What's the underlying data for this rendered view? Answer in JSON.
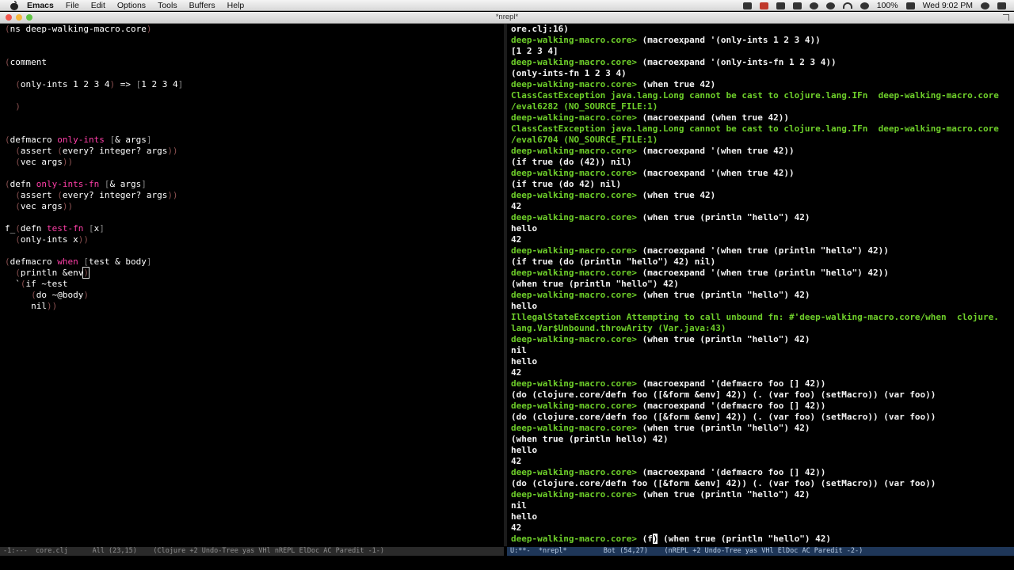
{
  "menubar": {
    "app": "Emacs",
    "items": [
      "File",
      "Edit",
      "Options",
      "Tools",
      "Buffers",
      "Help"
    ],
    "battery": "100%",
    "clock": "Wed 9:02 PM"
  },
  "window": {
    "title": "*nrepl*"
  },
  "editor": {
    "ns": "ns deep-walking-macro.core",
    "comment": "comment",
    "comment_body": "only-ints 1 2 3 4",
    "comment_arrow": " => ",
    "comment_result": "1 2 3 4",
    "defmacro1_kw": "defmacro",
    "defmacro1_name": "only-ints",
    "defmacro1_args": "& args",
    "assert1": "assert ",
    "every1": "every? integer? args",
    "vec1": "vec args",
    "defn1_kw": "defn",
    "defn1_name": "only-ints-fn",
    "defn1_args": "& args",
    "assert2": "assert ",
    "every2": "every? integer? args",
    "vec2": "vec args",
    "fringe_mark": "f_",
    "defn2_kw": "defn",
    "defn2_name": "test-fn",
    "defn2_args": "x",
    "only_ints_x": "only-ints x",
    "defmacro2_kw": "defmacro",
    "defmacro2_name": "when",
    "defmacro2_args": "test & body",
    "println_env": "println &env",
    "if_test": "if ~test",
    "do_body": "do ~@body",
    "nil": "nil"
  },
  "repl": {
    "lines": [
      {
        "t": "out",
        "s": "ore.clj:16)"
      },
      {
        "t": "prompt",
        "p": "deep-walking-macro.core> ",
        "s": "(macroexpand '(only-ints 1 2 3 4))"
      },
      {
        "t": "out",
        "s": "[1 2 3 4]"
      },
      {
        "t": "prompt",
        "p": "deep-walking-macro.core> ",
        "s": "(macroexpand '(only-ints-fn 1 2 3 4))"
      },
      {
        "t": "out",
        "s": "(only-ints-fn 1 2 3 4)"
      },
      {
        "t": "prompt",
        "p": "deep-walking-macro.core> ",
        "s": "(when true 42)"
      },
      {
        "t": "err",
        "s": "ClassCastException java.lang.Long cannot be cast to clojure.lang.IFn  deep-walking-macro.core"
      },
      {
        "t": "err",
        "s": "/eval6282 (NO_SOURCE_FILE:1)"
      },
      {
        "t": "prompt",
        "p": "deep-walking-macro.core> ",
        "s": "(macroexpand (when true 42))"
      },
      {
        "t": "err",
        "s": "ClassCastException java.lang.Long cannot be cast to clojure.lang.IFn  deep-walking-macro.core"
      },
      {
        "t": "err",
        "s": "/eval6704 (NO_SOURCE_FILE:1)"
      },
      {
        "t": "prompt",
        "p": "deep-walking-macro.core> ",
        "s": "(macroexpand '(when true 42))"
      },
      {
        "t": "out",
        "s": "(if true (do (42)) nil)"
      },
      {
        "t": "prompt",
        "p": "deep-walking-macro.core> ",
        "s": "(macroexpand '(when true 42))"
      },
      {
        "t": "out",
        "s": "(if true (do 42) nil)"
      },
      {
        "t": "prompt",
        "p": "deep-walking-macro.core> ",
        "s": "(when true 42)"
      },
      {
        "t": "out",
        "s": "42"
      },
      {
        "t": "prompt",
        "p": "deep-walking-macro.core> ",
        "s": "(when true (println \"hello\") 42)"
      },
      {
        "t": "out",
        "s": "hello"
      },
      {
        "t": "out",
        "s": "42"
      },
      {
        "t": "prompt",
        "p": "deep-walking-macro.core> ",
        "s": "(macroexpand '(when true (println \"hello\") 42))"
      },
      {
        "t": "out",
        "s": "(if true (do (println \"hello\") 42) nil)"
      },
      {
        "t": "prompt",
        "p": "deep-walking-macro.core> ",
        "s": "(macroexpand '(when true (println \"hello\") 42))"
      },
      {
        "t": "out",
        "s": "(when true (println \"hello\") 42)"
      },
      {
        "t": "prompt",
        "p": "deep-walking-macro.core> ",
        "s": "(when true (println \"hello\") 42)"
      },
      {
        "t": "out",
        "s": "hello"
      },
      {
        "t": "err",
        "s": "IllegalStateException Attempting to call unbound fn: #'deep-walking-macro.core/when  clojure."
      },
      {
        "t": "err",
        "s": "lang.Var$Unbound.throwArity (Var.java:43)"
      },
      {
        "t": "prompt",
        "p": "deep-walking-macro.core> ",
        "s": "(when true (println \"hello\") 42)"
      },
      {
        "t": "out",
        "s": "nil"
      },
      {
        "t": "out",
        "s": "hello"
      },
      {
        "t": "out",
        "s": "42"
      },
      {
        "t": "prompt",
        "p": "deep-walking-macro.core> ",
        "s": "(macroexpand '(defmacro foo [] 42))"
      },
      {
        "t": "out",
        "s": "(do (clojure.core/defn foo ([&form &env] 42)) (. (var foo) (setMacro)) (var foo))"
      },
      {
        "t": "prompt",
        "p": "deep-walking-macro.core> ",
        "s": "(macroexpand '(defmacro foo [] 42))"
      },
      {
        "t": "out",
        "s": "(do (clojure.core/defn foo ([&form &env] 42)) (. (var foo) (setMacro)) (var foo))"
      },
      {
        "t": "prompt",
        "p": "deep-walking-macro.core> ",
        "s": "(when true (println \"hello\") 42)"
      },
      {
        "t": "out",
        "s": "(when true (println hello) 42)"
      },
      {
        "t": "out",
        "s": "hello"
      },
      {
        "t": "out",
        "s": "42"
      },
      {
        "t": "prompt",
        "p": "deep-walking-macro.core> ",
        "s": "(macroexpand '(defmacro foo [] 42))"
      },
      {
        "t": "out",
        "s": "(do (clojure.core/defn foo ([&form &env] 42)) (. (var foo) (setMacro)) (var foo))"
      },
      {
        "t": "prompt",
        "p": "deep-walking-macro.core> ",
        "s": "(when true (println \"hello\") 42)"
      },
      {
        "t": "out",
        "s": "nil"
      },
      {
        "t": "out",
        "s": "hello"
      },
      {
        "t": "out",
        "s": "42"
      }
    ],
    "last_prompt": "deep-walking-macro.core> ",
    "last_input_pre": "(f",
    "last_input_cursor": ")",
    "last_input_post": " (when true (println \"hello\") 42)"
  },
  "modeline": {
    "left": "-1:---  core.clj      All (23,15)    (Clojure +2 Undo-Tree yas VHl nREPL ElDoc AC Paredit -1-)",
    "right": "U:**-  *nrepl*         Bot (54,27)    (nREPL +2 Undo-Tree yas VHl ElDoc AC Paredit -2-)"
  },
  "colors": {
    "prompt": "#6ecf2a",
    "keyword_name": "#ff3fa8",
    "paren": "#8a5050",
    "modeline_active": "#1e3658"
  }
}
